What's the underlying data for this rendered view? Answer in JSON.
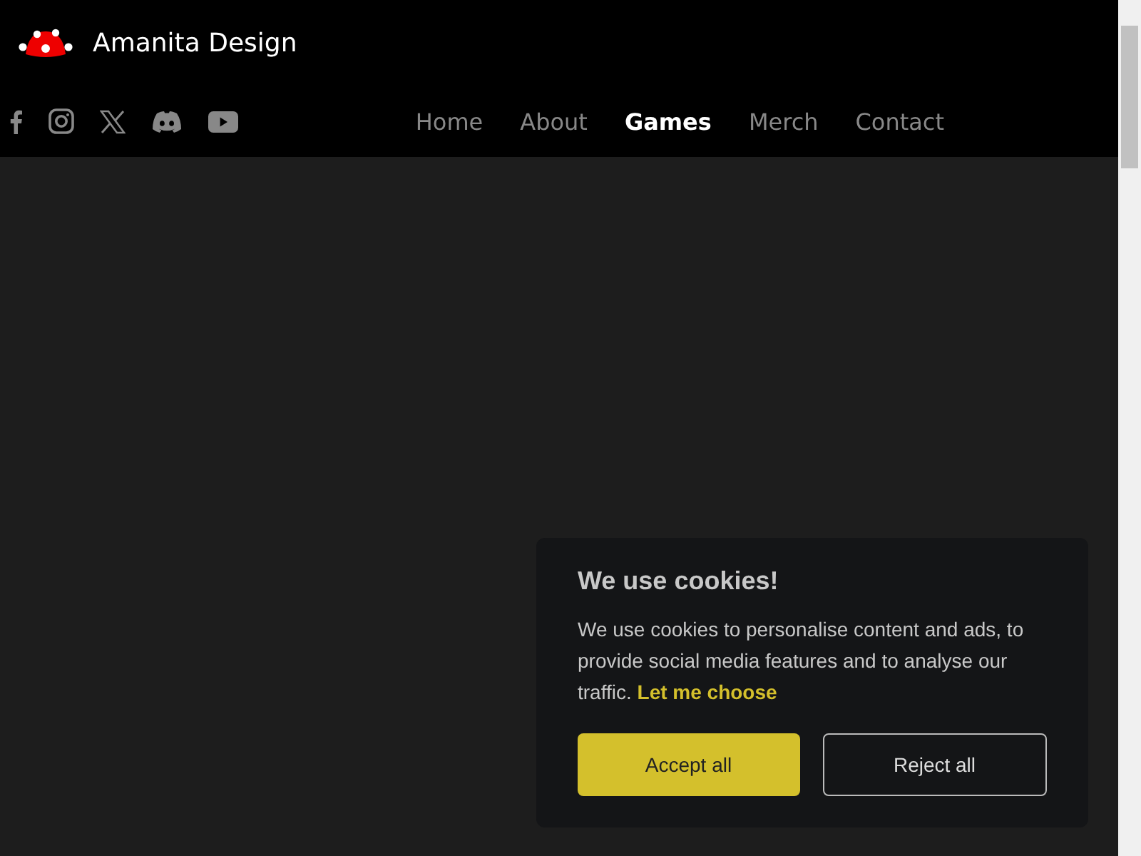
{
  "brand": {
    "name": "Amanita Design"
  },
  "nav": [
    {
      "label": "Home",
      "selected": false
    },
    {
      "label": "About",
      "selected": false
    },
    {
      "label": "Games",
      "selected": true
    },
    {
      "label": "Merch",
      "selected": false
    },
    {
      "label": "Contact",
      "selected": false
    }
  ],
  "cookie_banner": {
    "title": "We use cookies!",
    "message": "We use cookies to personalise content and ads, to provide social media features and to analyse our traffic.",
    "link": "Let me choose",
    "buttons": [
      {
        "label": "Accept all",
        "kind": "primary"
      },
      {
        "label": "Reject all",
        "kind": "outline"
      }
    ]
  }
}
